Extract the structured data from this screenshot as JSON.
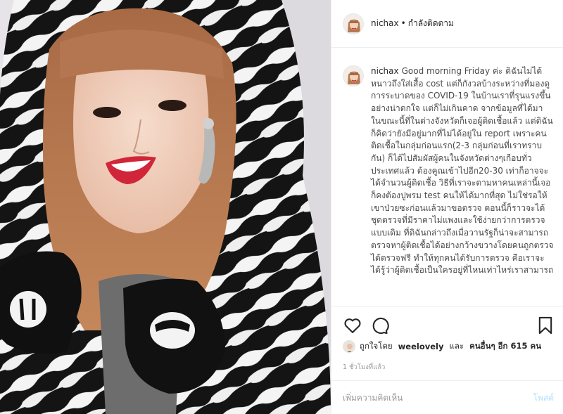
{
  "header": {
    "username": "nichax",
    "separator": "•",
    "follow_status": "กำลังติดตาม"
  },
  "caption": {
    "username": "nichax",
    "text": "Good morning Friday ค่ะ ดิฉันไม่ได้หนาวถึงใส่เสื้อ cost แต่ก็กังวลบ้างระหว่างที่มองดูการระบาดของ COVID-19 ในบ้านเราที่รุนแรงขึ้นอย่างน่าตกใจ แต่ก็ไม่เกินคาด จากข้อมูลที่ได้มา ในขณะนี้ที่ในต่างจังหวัดก็เจอผู้ติดเชื้อแล้ว แต่ดิฉันก็คิดว่ายังมีอยู่มากที่ไม่ได้อยู่ใน report เพราะคนติดเชื้อในกลุ่มก่อนแรก(2-3 กลุ่มก่อนที่เราทราบกัน) ก็ได้ไปสัมผัสผู้คนในจังหวัดต่างๆเกือบทั่วประเทศแล้ว ต้องคูณเข้าไปอีก20-30 เท่าก็อาจจะได้จำนวนผู้ติดเชื้อ วิธีที่เราจะตามหาคนเหล่านี้เจอก็คงต้องปูพรม test คนให้ได้มากที่สุด ไม่ใช่รอให้เขาป่วยซะก่อนแล้วมาขอตรวจ ตอนนี้ก็ราวจะได้ชุดตรวจที่มีราคาไม่แพงและใช้ง่ายกว่าการตรวจแบบเดิม ที่ดิฉันกล่าวถึงเมื่อวานรัฐก็น่าจะสามารถตรวจหาผู้ติดเชื้อได้อย่างกว้างขวางโดยคนถูกตรวจได้ตรวจฟรี ทำให้ทุกคนได้รับการตรวจ คือเราจะได้รู้ว่าผู้ติดเชื้อเป็นใครอยู่ที่ไหนเท่าไหร่เราสามารถ"
  },
  "actions": {
    "like_icon": "heart-icon",
    "comment_icon": "speech-bubble-icon",
    "save_icon": "bookmark-icon"
  },
  "likes": {
    "prefix": "ถูกใจโดย",
    "liker": "weelovely",
    "conjunction": "และ",
    "others": "คนอื่นๆ อีก 615 คน"
  },
  "timestamp": "1 ชั่วโมงที่แล้ว",
  "comment": {
    "placeholder": "เพิ่มความคิดเห็น",
    "post_label": "โพสต์"
  },
  "colors": {
    "text": "#262626",
    "muted": "#999999",
    "border": "#efefef",
    "post_disabled": "#b2dffc"
  }
}
